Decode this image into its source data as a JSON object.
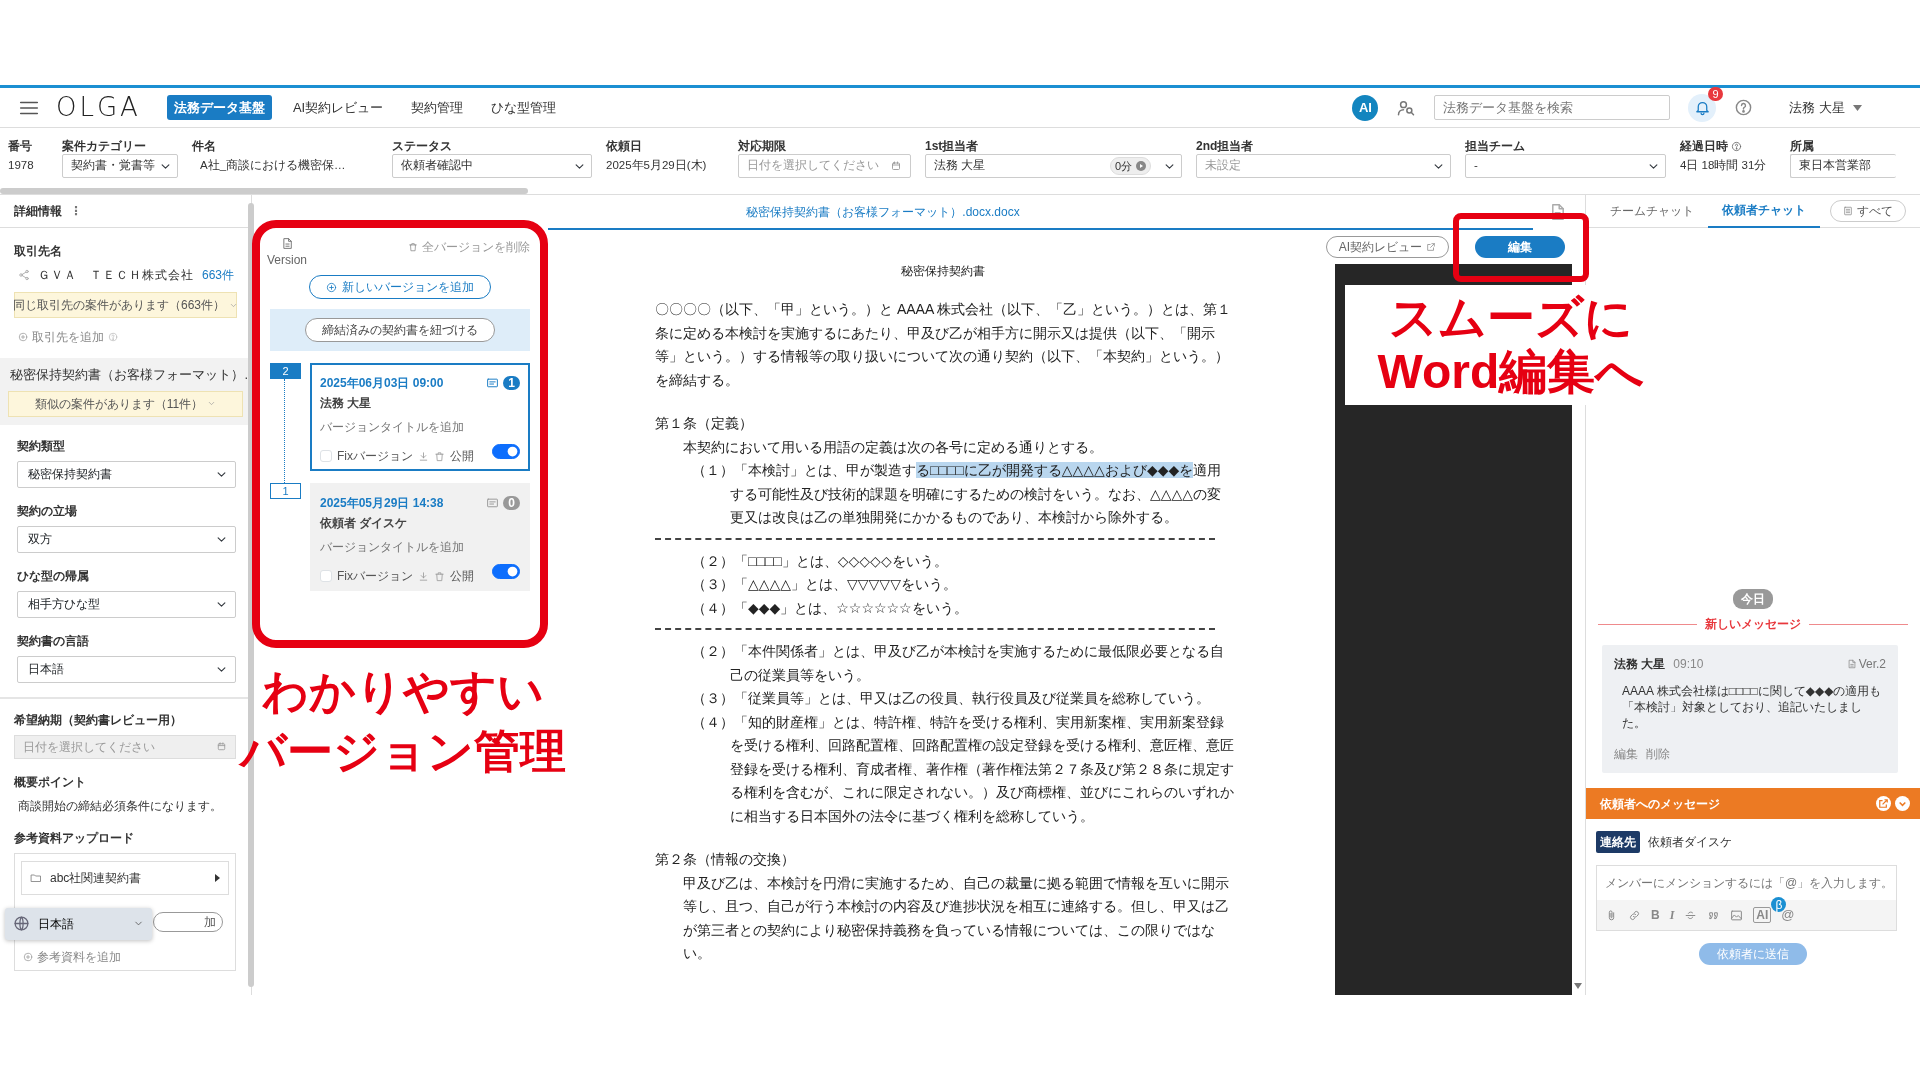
{
  "navbar": {
    "logo": "OLGA",
    "tabs": [
      {
        "label": "法務データ基盤",
        "selected": true
      },
      {
        "label": "AI契約レビュー",
        "selected": false
      },
      {
        "label": "契約管理",
        "selected": false
      },
      {
        "label": "ひな型管理",
        "selected": false
      }
    ],
    "ai_badge": "AI",
    "search": {
      "placeholder": "法務データ基盤を検索"
    },
    "notification_count": "9",
    "user": "法務 大星"
  },
  "case_fields": [
    {
      "label": "番号",
      "kind": "text",
      "value": "1978"
    },
    {
      "label": "案件カテゴリー",
      "kind": "select",
      "value": "契約書・覚書等"
    },
    {
      "label": "件名",
      "kind": "text",
      "value": "A社_商談における機密保…"
    },
    {
      "label": "ステータス",
      "kind": "select",
      "value": "依頼者確認中"
    },
    {
      "label": "依頼日",
      "kind": "text",
      "value": "2025年5月29日(木)"
    },
    {
      "label": "対応期限",
      "kind": "date",
      "placeholder": "日付を選択してください"
    },
    {
      "label": "1st担当者",
      "kind": "select",
      "value": "法務 大星",
      "timer": "0分"
    },
    {
      "label": "2nd担当者",
      "kind": "select",
      "placeholder": "未設定"
    },
    {
      "label": "担当チーム",
      "kind": "select",
      "value": "-"
    },
    {
      "label": "経過日時",
      "kind": "text",
      "value": "4日 18時間 31分",
      "info": true
    },
    {
      "label": "所属",
      "kind": "input",
      "value": "東日本営業部"
    }
  ],
  "details": {
    "title": "詳細情報",
    "menu_glyph": "⋮",
    "client": {
      "label": "取引先名",
      "name": "ＧＶＡ　ＴＥＣＨ株式会社",
      "count": "663件",
      "notice": "同じ取引先の案件があります（663件）",
      "add": "取引先を追加"
    },
    "contract": {
      "title": "秘密保持契約書（お客様フォーマット）…",
      "notice": "類似の案件があります（11件）",
      "fields": [
        {
          "label": "契約類型",
          "value": "秘密保持契約書"
        },
        {
          "label": "契約の立場",
          "value": "双方"
        },
        {
          "label": "ひな型の帰属",
          "value": "相手方ひな型"
        },
        {
          "label": "契約書の言語",
          "value": "日本語"
        }
      ]
    },
    "due": {
      "label": "希望納期（契約書レビュー用）",
      "placeholder": "日付を選択してください"
    },
    "summary": {
      "label": "概要ポイント",
      "text": "商談開始の締結必須条件になります。"
    },
    "upload": {
      "label": "参考資料アップロード",
      "folder": "abc社関連契約書",
      "button": "加",
      "add": "参考資料を追加"
    },
    "language": "日本語"
  },
  "versions": {
    "label": "Version",
    "delete_all": "全バージョンを削除",
    "add_button": "新しいバージョンを追加",
    "link_button": "締結済みの契約書を紐づける",
    "items": [
      {
        "number": "2",
        "selected": true,
        "date": "2025年06月03日 09:00",
        "author": "法務 大星",
        "title_placeholder": "バージョンタイトルを追加",
        "comments": "1",
        "fix_label": "Fixバージョン",
        "fixed": false,
        "public_label": "公開",
        "public": true
      },
      {
        "number": "1",
        "selected": false,
        "date": "2025年05月29日 14:38",
        "author": "依頼者 ダイスケ",
        "title_placeholder": "バージョンタイトルを追加",
        "comments": "0",
        "fix_label": "Fixバージョン",
        "fixed": false,
        "public_label": "公開",
        "public": true
      }
    ]
  },
  "document": {
    "filename": "秘密保持契約書（お客様フォーマット）.docx.docx",
    "review_button": "AI契約レビュー",
    "edit_button": "編集",
    "title": "秘密保持契約書",
    "blocks": [
      {
        "kind": "para",
        "segments": [
          {
            "text": "〇〇〇〇（以下、「甲」という。）と AAAA 株式会社（以下、「乙」という。）とは、第１条に定める本検討を実施するにあたり、甲及び乙が相手方に開示又は提供（以下、「開示等」という。）する情報等の取り扱いについて次の通り契約（以下、「本契約」という。）を締結する。",
            "highlighted": false
          }
        ]
      },
      {
        "kind": "heading",
        "segments": [
          {
            "text": "第１条（定義）",
            "highlighted": false
          }
        ]
      },
      {
        "kind": "body",
        "segments": [
          {
            "text": "本契約において用いる用語の定義は次の各号に定める通りとする。",
            "highlighted": false
          }
        ]
      },
      {
        "kind": "item",
        "segments": [
          {
            "text": "（１）「本検討」とは、甲が製造す",
            "highlighted": false
          },
          {
            "text": "る□□□□に乙が開発する△△△△および◆◆◆を",
            "highlighted": true
          },
          {
            "text": "適用する可能性及び技術的課題を明確にするための検討をいう。なお、△△△△の変更又は改良は乙の単独開発にかかるものであり、本検討から除外する。",
            "highlighted": false
          }
        ]
      },
      {
        "kind": "divider"
      },
      {
        "kind": "item",
        "segments": [
          {
            "text": "（２）「□□□□」とは、◇◇◇◇◇をいう。",
            "highlighted": false
          }
        ]
      },
      {
        "kind": "item",
        "segments": [
          {
            "text": "（３）「△△△△」とは、▽▽▽▽▽をいう。",
            "highlighted": false
          }
        ]
      },
      {
        "kind": "item",
        "segments": [
          {
            "text": "（４）「◆◆◆」とは、☆☆☆☆☆☆をいう。",
            "highlighted": false
          }
        ]
      },
      {
        "kind": "divider"
      },
      {
        "kind": "item",
        "segments": [
          {
            "text": "（２）「本件関係者」とは、甲及び乙が本検討を実施するために最低限必要となる自己の従業員等をいう。",
            "highlighted": false
          }
        ]
      },
      {
        "kind": "item",
        "segments": [
          {
            "text": "（３）「従業員等」とは、甲又は乙の役員、執行役員及び従業員を総称していう。",
            "highlighted": false
          }
        ]
      },
      {
        "kind": "item",
        "segments": [
          {
            "text": "（４）「知的財産権」とは、特許権、特許を受ける権利、実用新案権、実用新案登録を受ける権利、回路配置権、回路配置権の設定登録を受ける権利、意匠権、意匠登録を受ける権利、育成者権、著作権（著作権法第２７条及び第２８条に規定する権利を含むが、これに限定されない。）及び商標権、並びにこれらのいずれかに相当する日本国外の法令に基づく権利を総称していう。",
            "highlighted": false
          }
        ]
      },
      {
        "kind": "heading",
        "segments": [
          {
            "text": "第２条（情報の交換）",
            "highlighted": false
          }
        ]
      },
      {
        "kind": "body",
        "segments": [
          {
            "text": "甲及び乙は、本検討を円滑に実施するため、自己の裁量に拠る範囲で情報を互いに開示等し、且つ、自己が行う本検討の内容及び進捗状況を相互に連絡する。但し、甲又は乙が第三者との契約により秘密保持義務を負っている情報については、この限りではない。",
            "highlighted": false
          }
        ]
      }
    ]
  },
  "chat": {
    "tabs": [
      {
        "label": "チームチャット",
        "selected": false
      },
      {
        "label": "依頼者チャット",
        "selected": true
      }
    ],
    "filter_button": "すべて",
    "day_label": "今日",
    "new_label": "新しいメッセージ",
    "messages": [
      {
        "author": "法務 大星",
        "time": "09:10",
        "version": "Ver.2",
        "text": "AAAA 株式会社様は□□□□に関して◆◆◆の適用も「本検討」対象としており、追記いたしました。",
        "actions": [
          "編集",
          "削除"
        ]
      }
    ],
    "composer": {
      "title": "依頼者へのメッセージ",
      "recipient_tag": "連絡先",
      "recipient": "依頼者ダイスケ",
      "placeholder": "メンバーにメンションするには「@」を入力します。",
      "toolbar": [
        {
          "kind": "attach"
        },
        {
          "kind": "link"
        },
        {
          "kind": "bold",
          "glyph": "B"
        },
        {
          "kind": "italic",
          "glyph": "I"
        },
        {
          "kind": "strike"
        },
        {
          "kind": "quote"
        },
        {
          "kind": "image"
        },
        {
          "kind": "ai",
          "glyph": "AI",
          "beta": "β"
        },
        {
          "kind": "mention",
          "glyph": "@"
        }
      ],
      "send_button": "依頼者に送信",
      "send_disabled": true
    }
  },
  "callouts": [
    {
      "kind": "versions",
      "lines": [
        "わかりやすい",
        "バージョン管理"
      ]
    },
    {
      "kind": "edit",
      "lines": [
        "スムーズに",
        "Word編集へ"
      ]
    }
  ]
}
